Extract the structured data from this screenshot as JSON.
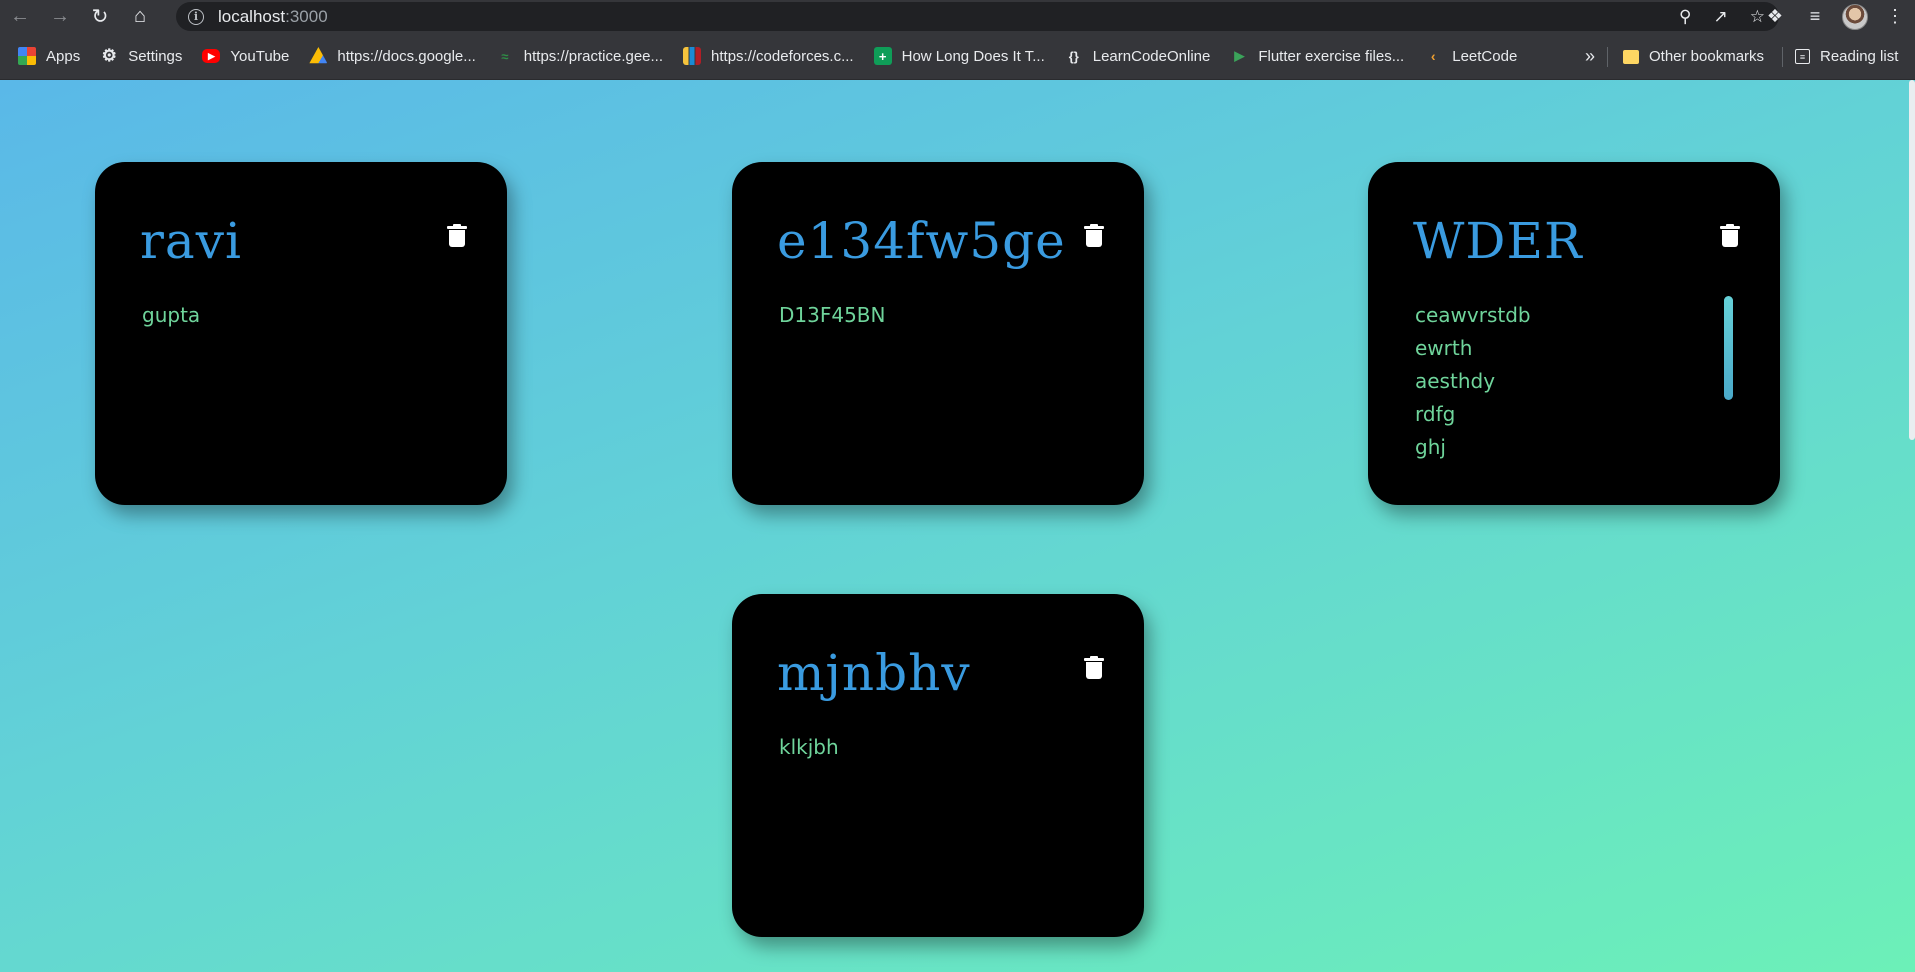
{
  "browser": {
    "url_host": "localhost",
    "url_port": ":3000",
    "bookmarks": [
      {
        "label": "Apps",
        "icon": "apps-grid-icon"
      },
      {
        "label": "Settings",
        "icon": "gear-icon"
      },
      {
        "label": "YouTube",
        "icon": "youtube-icon"
      },
      {
        "label": "https://docs.google...",
        "icon": "google-drive-icon"
      },
      {
        "label": "https://practice.gee...",
        "icon": "geeksforgeeks-icon"
      },
      {
        "label": "https://codeforces.c...",
        "icon": "codeforces-icon"
      },
      {
        "label": "How Long Does It T...",
        "icon": "sheets-icon"
      },
      {
        "label": "LearnCodeOnline",
        "icon": "braces-icon"
      },
      {
        "label": "Flutter exercise files...",
        "icon": "play-icon"
      },
      {
        "label": "LeetCode",
        "icon": "leetcode-icon"
      }
    ],
    "more": "»",
    "other_bookmarks": "Other bookmarks",
    "reading_list": "Reading list"
  },
  "notes": [
    {
      "title": "ravi",
      "lines": [
        "gupta"
      ]
    },
    {
      "title": "e134fw5ge",
      "lines": [
        "D13F45BN"
      ]
    },
    {
      "title": "WDER",
      "lines": [
        "ceawvrstdb",
        "ewrth",
        "aesthdy",
        "rdfg",
        "ghj"
      ]
    },
    {
      "title": "mjnbhv",
      "lines": [
        "klkjbh"
      ]
    }
  ],
  "colors": {
    "title": "#3a9be0",
    "content": "#6fd49b",
    "card": "#000000"
  }
}
